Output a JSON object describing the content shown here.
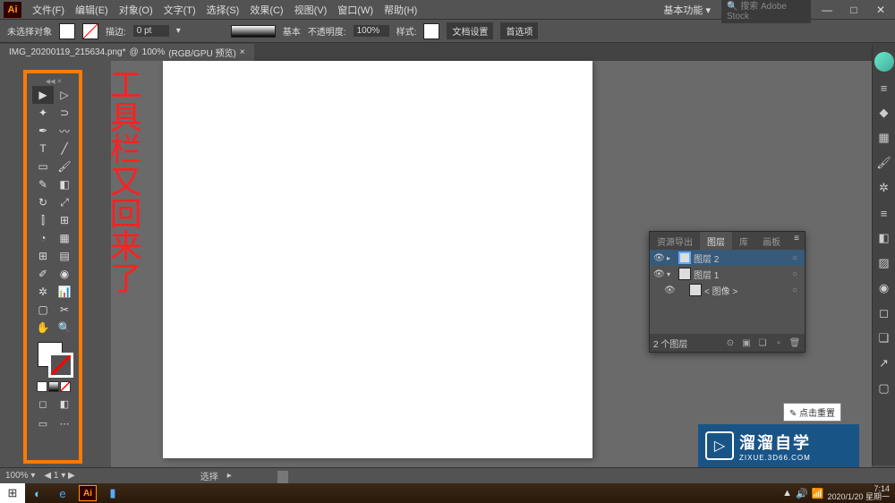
{
  "menu": {
    "file": "文件(F)",
    "edit": "编辑(E)",
    "object": "对象(O)",
    "type": "文字(T)",
    "select": "选择(S)",
    "effect": "效果(C)",
    "view": "视图(V)",
    "window": "窗口(W)",
    "help": "帮助(H)"
  },
  "workspace": "基本功能",
  "search_placeholder": "搜索 Adobe Stock",
  "control": {
    "no_selection": "未选择对象",
    "stroke_label": "描边:",
    "stroke_val": "0 pt",
    "basic": "基本",
    "opacity_label": "不透明度:",
    "opacity_val": "100%",
    "style_label": "样式:",
    "doc_setup": "文档设置",
    "prefs": "首选项"
  },
  "tab": {
    "name": "IMG_20200119_215634.png*",
    "zoom": "100%",
    "mode": "(RGB/GPU 预览)"
  },
  "annotation": "工具栏又回来了",
  "layers": {
    "tabs": {
      "asset": "资源导出",
      "layers": "图层",
      "lib": "库",
      "artboard": "画板"
    },
    "items": [
      {
        "name": "图层 2"
      },
      {
        "name": "图层 1"
      },
      {
        "name": "< 图像 >"
      }
    ],
    "footer": "2 个图层"
  },
  "status": {
    "zoom": "100%",
    "artboard": "1",
    "tool": "选择"
  },
  "taskbar": {
    "time": "7:14",
    "date": "2020/1/20 星期一"
  },
  "watermark": {
    "brand": "溜溜自学",
    "url": "ZIXUE.3D66.COM"
  },
  "tooltip": "点击重置"
}
